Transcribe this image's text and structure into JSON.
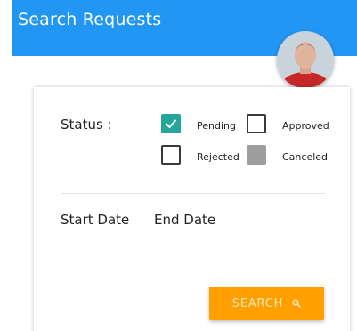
{
  "header": {
    "title": "Search Requests",
    "color": "#2196f3"
  },
  "user": {
    "avatar_icon": "user-avatar"
  },
  "filters": {
    "status_label": "Status :",
    "options": [
      {
        "label": "Pending",
        "checked": true
      },
      {
        "label": "Approved",
        "checked": false
      },
      {
        "label": "Rejected",
        "checked": false
      },
      {
        "label": "Canceled",
        "checked": false,
        "disabled": true
      }
    ],
    "start_date_label": "Start Date",
    "start_date_value": "",
    "end_date_label": "End Date",
    "end_date_value": ""
  },
  "search_button": {
    "label": "SEARCH",
    "icon": "search-icon",
    "color": "#ffa000"
  }
}
